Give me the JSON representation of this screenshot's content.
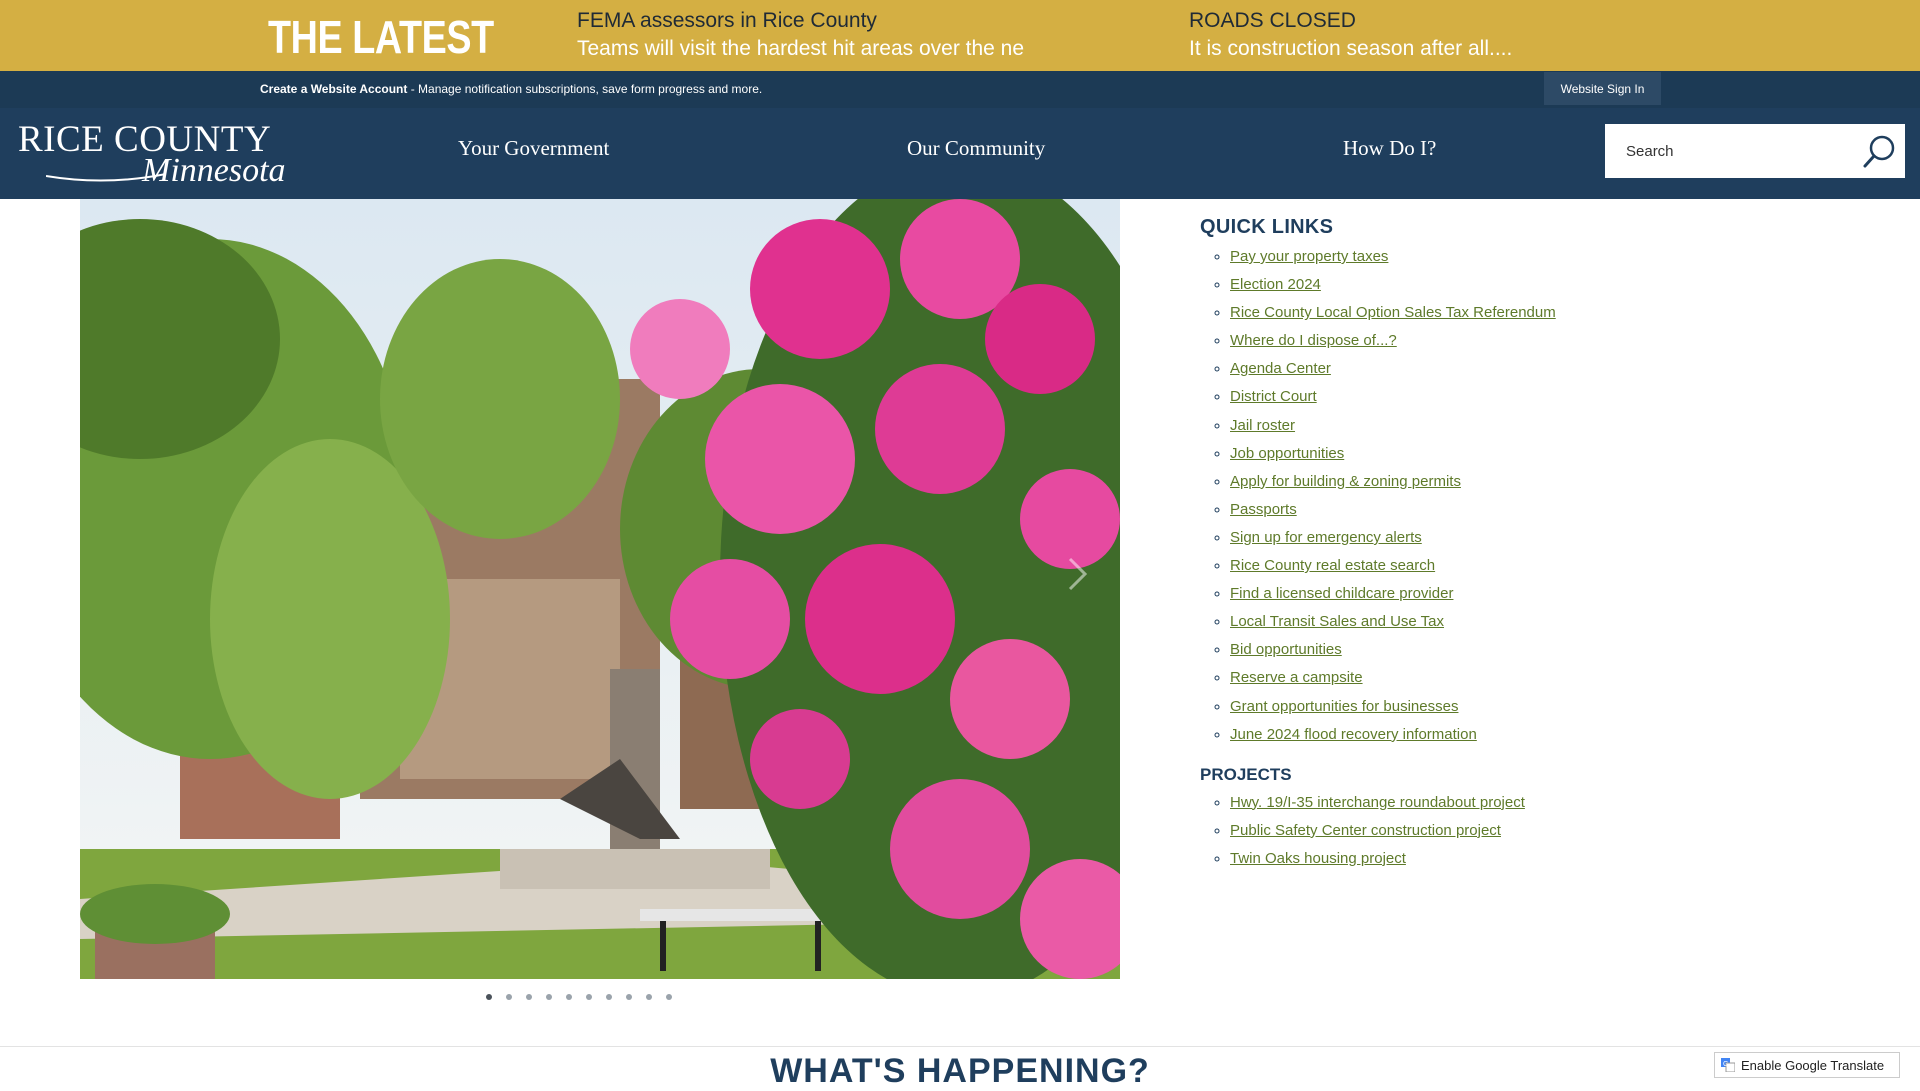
{
  "latest": {
    "title": "THE LATEST",
    "items": [
      {
        "headline": "FEMA assessors in Rice County",
        "summary": "Teams will visit the hardest hit areas over the ne"
      },
      {
        "headline": "ROADS CLOSED",
        "summary": "It is construction season after all...."
      }
    ]
  },
  "account": {
    "create_label": "Create a Website Account",
    "create_desc": " - Manage notification subscriptions, save form progress and more.",
    "signin_label": "Website Sign In"
  },
  "header": {
    "logo_line1": "RICE COUNTY",
    "logo_line2": "Minnesota",
    "nav": [
      "Your Government",
      "Our Community",
      "How Do I?"
    ],
    "search_placeholder": "Search"
  },
  "slideshow": {
    "slide_count": 10,
    "active_index": 0
  },
  "quick_links": {
    "title": "QUICK LINKS",
    "items": [
      "Pay your property taxes",
      "Election 2024",
      "Rice County Local Option Sales Tax Referendum",
      "Where do I dispose of...?",
      "Agenda Center",
      "District Court",
      "Jail roster",
      "Job opportunities",
      "Apply for building & zoning permits",
      "Passports",
      "Sign up for emergency alerts",
      "Rice County real estate search",
      "Find a licensed childcare provider",
      "Local Transit Sales and Use Tax",
      "Bid opportunities",
      "Reserve a campsite",
      "Grant opportunities for businesses",
      "June 2024 flood recovery information"
    ]
  },
  "projects": {
    "title": "PROJECTS",
    "items": [
      "Hwy. 19/I-35 interchange roundabout project",
      "Public Safety Center construction project",
      "Twin Oaks housing project "
    ]
  },
  "happening": {
    "title": "WHAT'S HAPPENING?"
  },
  "translate": {
    "label": "Enable Google Translate"
  },
  "colors": {
    "gold": "#d4af43",
    "navy": "#1f3e5d",
    "link_green": "#5e7a2a"
  }
}
